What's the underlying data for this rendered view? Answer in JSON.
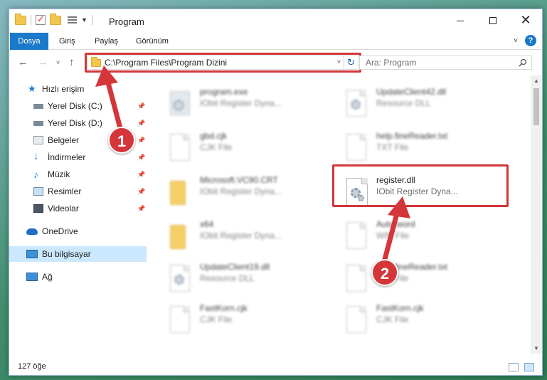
{
  "window": {
    "title": "Program",
    "minimize": "—",
    "close": "✕"
  },
  "ribbon": {
    "tabs": [
      "Dosya",
      "Giriş",
      "Paylaş",
      "Görünüm"
    ],
    "help": "?"
  },
  "nav": {
    "back": "←",
    "forward": "→",
    "recent": "˅",
    "up": "↑",
    "address": "C:\\Program Files\\Program Dizini",
    "address_caret": "˅",
    "refresh": "↻",
    "search_placeholder": "Ara: Program"
  },
  "sidebar": {
    "items": [
      {
        "label": "Hızlı erişim",
        "icon": "star-icon",
        "pinned": false
      },
      {
        "label": "Yerel Disk (C:)",
        "icon": "drive-icon",
        "pinned": true
      },
      {
        "label": "Yerel Disk (D:)",
        "icon": "drive-icon",
        "pinned": true
      },
      {
        "label": "Belgeler",
        "icon": "documents-icon",
        "pinned": true
      },
      {
        "label": "İndirmeler",
        "icon": "download-icon",
        "pinned": true
      },
      {
        "label": "Müzik",
        "icon": "music-icon",
        "pinned": true
      },
      {
        "label": "Resimler",
        "icon": "pictures-icon",
        "pinned": true
      },
      {
        "label": "Videolar",
        "icon": "videos-icon",
        "pinned": true
      },
      {
        "label": "OneDrive",
        "icon": "cloud-icon",
        "pinned": false
      },
      {
        "label": "Bu bilgisayar",
        "icon": "computer-icon",
        "pinned": false,
        "selected": true
      },
      {
        "label": "Ağ",
        "icon": "network-icon",
        "pinned": false
      }
    ],
    "pin_glyph": "📌"
  },
  "files": {
    "items": [
      {
        "name": "program.exe",
        "desc": "IObit Register Dyna...",
        "type": "exe"
      },
      {
        "name": "UpdateClient42.dll",
        "desc": "Resource DLL",
        "type": "dll"
      },
      {
        "name": "gbd.cjk",
        "desc": "CJK File",
        "type": "doc"
      },
      {
        "name": "help.fineReader.txt",
        "desc": "TXT File",
        "type": "doc"
      },
      {
        "name": "Microsoft.VC90.CRT",
        "desc": "IObit Register Dyna...",
        "type": "folder"
      },
      {
        "name": "register.dll",
        "desc": "IObit Register Dyna...",
        "type": "dll",
        "highlighted": true
      },
      {
        "name": "x64",
        "desc": "IObit Register Dyna...",
        "type": "folder"
      },
      {
        "name": "Autorword",
        "desc": "WIN File",
        "type": "doc"
      },
      {
        "name": "UpdateClient19.dll",
        "desc": "Resource DLL",
        "type": "dll"
      },
      {
        "name": "help.fineReader.txt",
        "desc": "TXT File",
        "type": "doc"
      },
      {
        "name": "FastKorn.cjk",
        "desc": "CJK File",
        "type": "doc"
      },
      {
        "name": "FastKorn.cjk",
        "desc": "CJK File",
        "type": "doc"
      }
    ]
  },
  "status": {
    "count": "127 öğe"
  },
  "callouts": {
    "one": "1",
    "two": "2"
  },
  "colors": {
    "accent": "#1979ca",
    "annotation": "#d4363a",
    "selected": "#cce8ff"
  }
}
